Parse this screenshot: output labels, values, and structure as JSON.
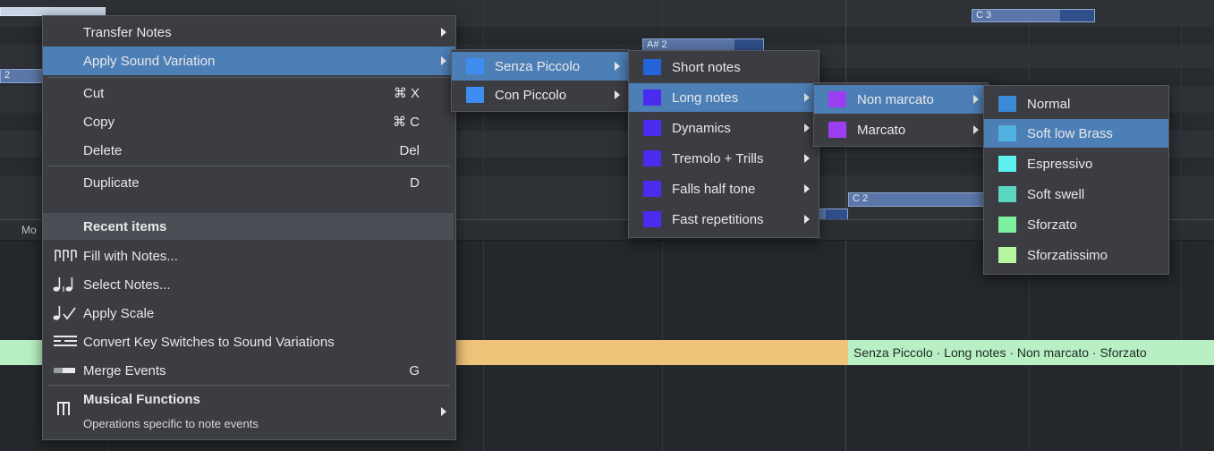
{
  "background": {
    "notes": [
      {
        "label": "",
        "name": "note-top-left"
      },
      {
        "label": "A# 2",
        "name": "note-a-sharp-2"
      },
      {
        "label": "C 3",
        "name": "note-c3"
      },
      {
        "label": "C 2",
        "name": "note-c2"
      },
      {
        "label": "2",
        "name": "note-left-2"
      }
    ],
    "lane_label": "Mo",
    "sound_variation_label": "Senza Piccolo · Long notes · Non marcato · Sforzato",
    "colors": {
      "orange": "#eec37a",
      "green": "#b8f0c4",
      "note": "#5b76a8"
    }
  },
  "main_menu": {
    "items": [
      {
        "label": "Transfer Notes",
        "shortcut": "",
        "submenu": true
      },
      {
        "label": "Apply Sound Variation",
        "shortcut": "",
        "submenu": true,
        "selected": true
      },
      {
        "label": "Cut",
        "shortcut": "⌘ X"
      },
      {
        "label": "Copy",
        "shortcut": "⌘ C"
      },
      {
        "label": "Delete",
        "shortcut": "Del"
      },
      {
        "label": "Duplicate",
        "shortcut": "D"
      }
    ],
    "recent_header": "Recent items",
    "recent_items": [
      {
        "label": "Fill with Notes...",
        "icon": "notes-fill-icon"
      },
      {
        "label": "Select Notes...",
        "icon": "notes-select-icon"
      },
      {
        "label": "Apply Scale",
        "icon": "note-check-icon"
      },
      {
        "label": "Convert Key Switches to Sound Variations",
        "icon": "key-switch-icon"
      },
      {
        "label": "Merge Events",
        "shortcut": "G",
        "icon": "merge-icon"
      }
    ],
    "musical_functions": {
      "title": "Musical Functions",
      "subtitle": "Operations specific to note events",
      "icon": "piano-keys-icon"
    }
  },
  "submenu_1": {
    "items": [
      {
        "label": "Senza Piccolo",
        "color": "#3d8ef0",
        "selected": true
      },
      {
        "label": "Con Piccolo",
        "color": "#3d8ef0"
      }
    ]
  },
  "submenu_2": {
    "items": [
      {
        "label": "Short notes",
        "color": "#2563d9",
        "submenu": false
      },
      {
        "label": "Long notes",
        "color": "#4a2cf0",
        "submenu": true,
        "selected": true
      },
      {
        "label": "Dynamics",
        "color": "#4a2cf0",
        "submenu": true
      },
      {
        "label": "Tremolo + Trills",
        "color": "#4a2cf0",
        "submenu": true
      },
      {
        "label": "Falls half tone",
        "color": "#4a2cf0",
        "submenu": true
      },
      {
        "label": "Fast repetitions",
        "color": "#4a2cf0",
        "submenu": true
      }
    ]
  },
  "submenu_3": {
    "items": [
      {
        "label": "Non marcato",
        "color": "#9b3df0",
        "selected": true
      },
      {
        "label": "Marcato",
        "color": "#9b3df0"
      }
    ]
  },
  "submenu_4": {
    "items": [
      {
        "label": "Normal",
        "color": "#3a8ad8"
      },
      {
        "label": "Soft low Brass",
        "color": "#4fb2e0",
        "selected": true
      },
      {
        "label": "Espressivo",
        "color": "#5ff0f2"
      },
      {
        "label": "Soft swell",
        "color": "#5ad6c0"
      },
      {
        "label": "Sforzato",
        "color": "#7ef0a0"
      },
      {
        "label": "Sforzatissimo",
        "color": "#b8f5a0"
      }
    ]
  }
}
